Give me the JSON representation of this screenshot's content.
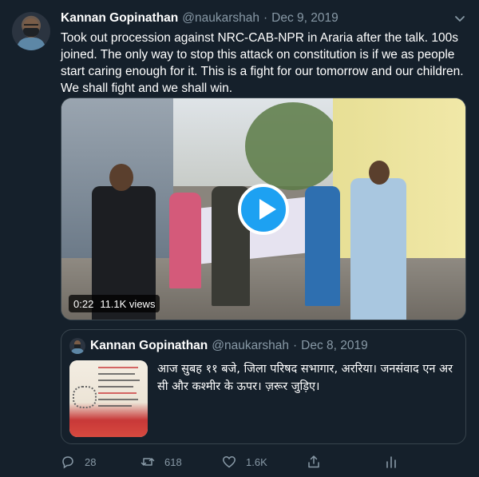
{
  "tweet": {
    "author": {
      "display_name": "Kannan Gopinathan",
      "handle": "@naukarshah"
    },
    "separator": "·",
    "date": "Dec 9, 2019",
    "text": "Took out procession against NRC-CAB-NPR in Araria after the talk. 100s joined. The only way to stop this attack on constitution is if we as people start caring enough for it. This is a fight for our tomorrow and our children. We shall fight and we shall win.",
    "video": {
      "duration": "0:22",
      "views": "11.1K views"
    },
    "actions": {
      "replies": "28",
      "retweets": "618",
      "likes": "1.6K"
    }
  },
  "quoted_tweet": {
    "author": {
      "display_name": "Kannan Gopinathan",
      "handle": "@naukarshah"
    },
    "separator": "·",
    "date": "Dec 8, 2019",
    "text": "आज सुबह ११ बजे, जिला परिषद सभागार, अररिया। जनसंवाद एन अर सी और कश्मीर के ऊपर। ज़रूर जुड़िए।"
  },
  "icons": {
    "caret": "chevron-down-icon",
    "play": "play-icon",
    "reply": "reply-icon",
    "retweet": "retweet-icon",
    "like": "heart-icon",
    "share": "share-icon",
    "analytics": "analytics-icon"
  },
  "colors": {
    "background": "#15202b",
    "text": "#ffffff",
    "secondary": "#8899a6",
    "accent": "#1da1f2",
    "border": "#38444d"
  }
}
